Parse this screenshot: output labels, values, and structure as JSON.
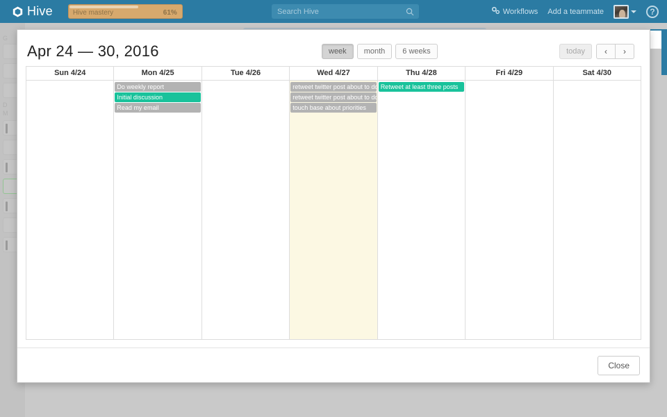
{
  "navbar": {
    "brand": "Hive",
    "brand_icon": "hexagon-logo-icon",
    "mastery": {
      "label": "Hive mastery",
      "percent_label": "61%",
      "percent": 61,
      "bar_color": "#d7a96d",
      "fill_color": "#e8d4b4"
    },
    "search": {
      "placeholder": "Search Hive",
      "value": "",
      "icon": "search-icon"
    },
    "workflows_label": "Workflows",
    "workflows_icon": "gears-icon",
    "add_teammate_label": "Add a teammate",
    "avatar_icon": "user-avatar",
    "caret_icon": "chevron-down-icon",
    "help_label": "?",
    "background_color": "#2b7ba3"
  },
  "modal": {
    "title": "Apr 24 — 30, 2016",
    "views": [
      {
        "label": "week",
        "active": true
      },
      {
        "label": "month",
        "active": false
      },
      {
        "label": "6 weeks",
        "active": false
      }
    ],
    "today_label": "today",
    "prev_icon": "chevron-left-icon",
    "next_icon": "chevron-right-icon",
    "prev_label": "‹",
    "next_label": "›",
    "close_label": "Close"
  },
  "calendar": {
    "today_highlight_color": "#fcf8e3",
    "event_colors": {
      "grey": "#b3b3b3",
      "teal": "#19c29b"
    },
    "days": [
      {
        "header": "Sun 4/24",
        "today": false,
        "events": []
      },
      {
        "header": "Mon 4/25",
        "today": false,
        "events": [
          {
            "title": "Do weekly report",
            "color": "grey"
          },
          {
            "title": "Initial discussion",
            "color": "teal"
          },
          {
            "title": "Read my email",
            "color": "grey"
          }
        ]
      },
      {
        "header": "Tue 4/26",
        "today": false,
        "events": []
      },
      {
        "header": "Wed 4/27",
        "today": true,
        "events": [
          {
            "title": "retweet twitter post about to do list b",
            "color": "grey"
          },
          {
            "title": "retweet twitter post about to do list b",
            "color": "grey"
          },
          {
            "title": "touch base about priorities",
            "color": "grey"
          }
        ]
      },
      {
        "header": "Thu 4/28",
        "today": false,
        "events": [
          {
            "title": "Retweet at least three posts",
            "color": "teal"
          }
        ]
      },
      {
        "header": "Fri 4/29",
        "today": false,
        "events": []
      },
      {
        "header": "Sat 4/30",
        "today": false,
        "events": []
      }
    ]
  }
}
